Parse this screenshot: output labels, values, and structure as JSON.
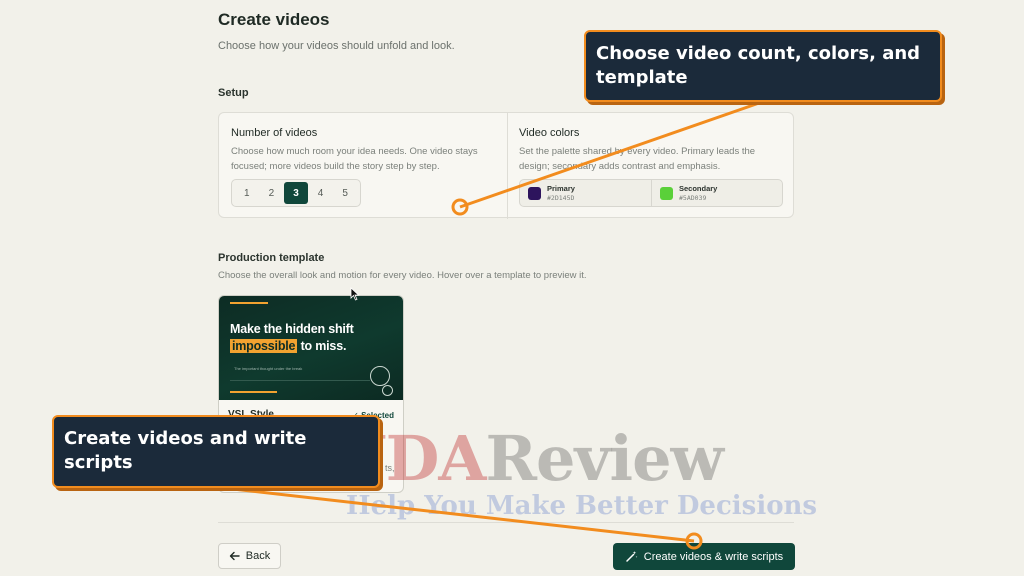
{
  "header": {
    "title": "Create videos",
    "subtitle": "Choose how your videos should unfold and look."
  },
  "setup": {
    "label": "Setup",
    "count": {
      "title": "Number of videos",
      "description": "Choose how much room your idea needs. One video stays focused; more videos build the story step by step.",
      "options": [
        "1",
        "2",
        "3",
        "4",
        "5"
      ],
      "selected": "3"
    },
    "colors": {
      "title": "Video colors",
      "description": "Set the palette shared by every video. Primary leads the design; secondary adds contrast and emphasis.",
      "primary": {
        "label": "Primary",
        "hex": "#2D145D"
      },
      "secondary": {
        "label": "Secondary",
        "hex": "#5AD039"
      }
    }
  },
  "template_section": {
    "label": "Production template",
    "description": "Choose the overall look and motion for every video. Hover over a template to preview it.",
    "card": {
      "headline_pre": "Make the hidden shift",
      "headline_highlight": "impossible",
      "headline_post": "to miss.",
      "small_text": "The important thought under the break",
      "name": "VSL Style",
      "selected_label": "✓ Selected",
      "partial_text": "ts,"
    }
  },
  "footer": {
    "back_label": "Back",
    "create_label": "Create videos & write scripts"
  },
  "annotations": {
    "callout_top": "Choose video count, colors, and template",
    "callout_bottom": "Create videos and write scripts",
    "color": "#f28c1e"
  },
  "watermark": {
    "brand_a": "HUDA",
    "brand_b": "Review",
    "tagline": "Help You Make Better Decisions"
  }
}
